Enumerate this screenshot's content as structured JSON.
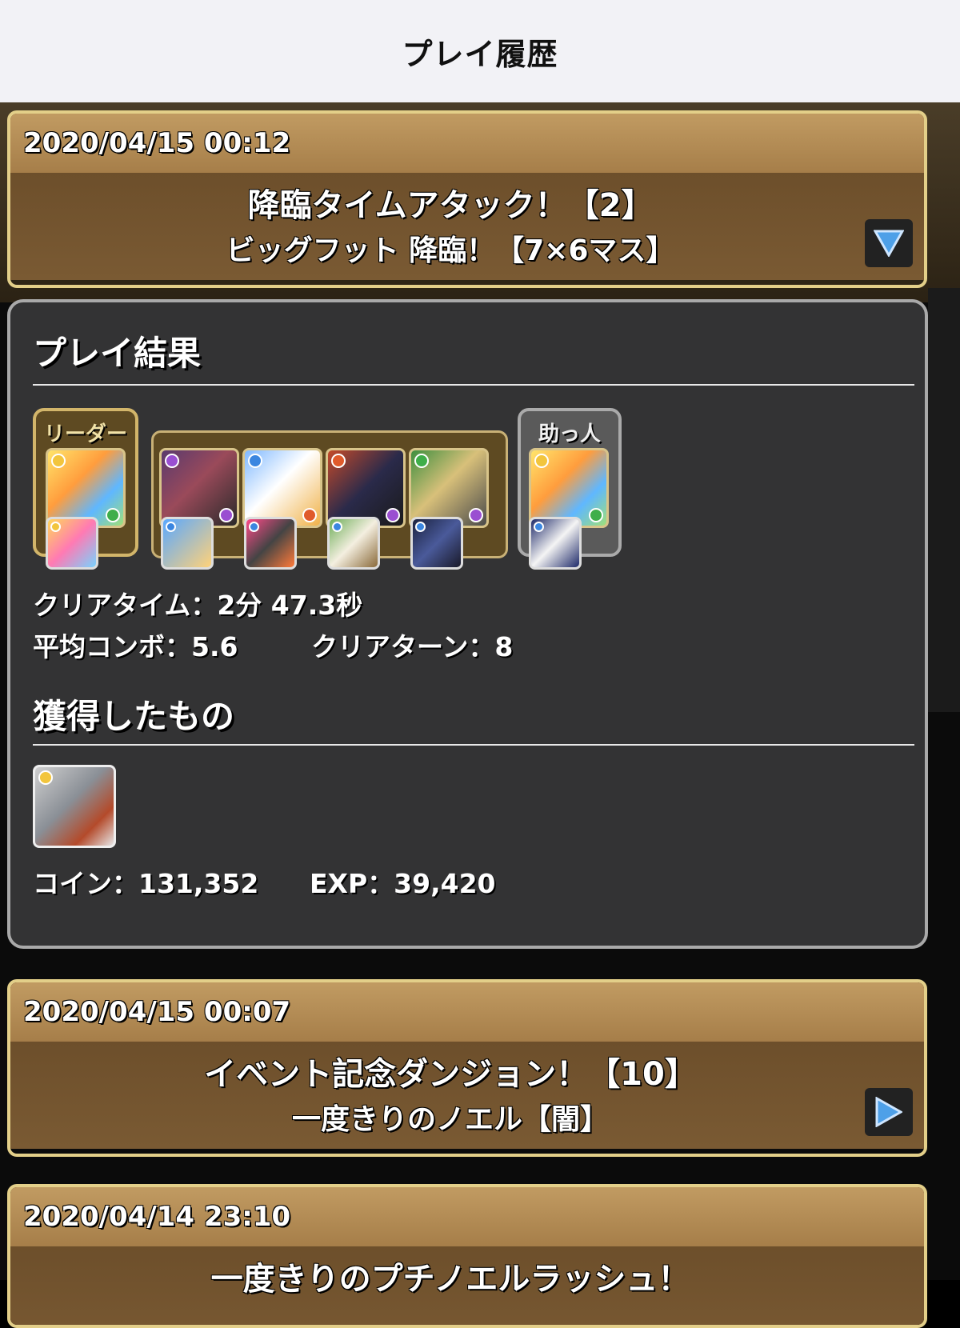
{
  "header": {
    "title": "プレイ履歴"
  },
  "entries": [
    {
      "date": "2020/04/15 00:12",
      "dungeon": "降臨タイムアタック！【2】",
      "floor": "ビッグフット 降臨！【7×6マス】",
      "toggle_icon": "triangle-down-icon"
    },
    {
      "date": "2020/04/15 00:07",
      "dungeon": "イベント記念ダンジョン！【10】",
      "floor": "一度きりのノエル【闇】",
      "toggle_icon": "triangle-right-icon"
    },
    {
      "date": "2020/04/14 23:10",
      "dungeon": "一度きりのプチノエルラッシュ！",
      "floor": ""
    }
  ],
  "result": {
    "section_title": "プレイ結果",
    "leader_label": "リーダー",
    "helper_label": "助っ人",
    "clear_time": "クリアタイム：2分 47.3秒",
    "avg_combo": "平均コンボ：5.6",
    "clear_turns": "クリアターン：8",
    "obtained_title": "獲得したもの",
    "coins": "コイン：131,352",
    "exp": "EXP：39,420"
  },
  "colors": {
    "light": "#f2c53d",
    "dark": "#9a4fd1",
    "water": "#3b86e0",
    "fire": "#e05a2b",
    "wood": "#3fae4a"
  }
}
